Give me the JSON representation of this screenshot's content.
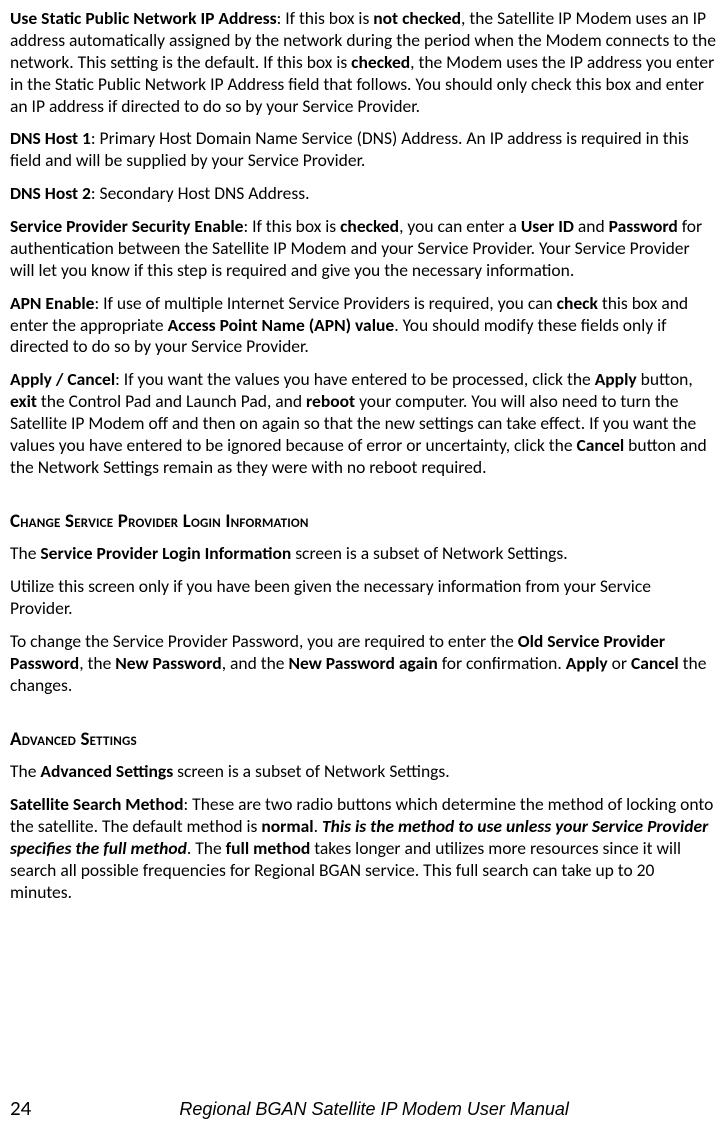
{
  "paragraphs": {
    "p1_b1": "Use Static Public Network IP Address",
    "p1_t1": ": If this box is ",
    "p1_b2": "not checked",
    "p1_t2": ", the Satellite IP Modem uses an IP address automatically assigned by the network during the period when the Modem connects to the network. This setting is the default. If this box is ",
    "p1_b3": "checked",
    "p1_t3": ", the Modem uses the IP address you enter in the Static Public Network IP Address field that follows. You should only check this box and enter an IP address if directed to do so by your Service Provider.",
    "p2_b1": "DNS Host 1",
    "p2_t1": ": Primary Host Domain Name Service (DNS) Address. An IP address is required in this field and will be supplied by your Service Provider.",
    "p3_b1": "DNS Host 2",
    "p3_t1": ": Secondary Host DNS Address.",
    "p4_b1": "Service Provider Security Enable",
    "p4_t1": ": If this box is ",
    "p4_b2": "checked",
    "p4_t2": ", you can enter a ",
    "p4_b3": "User ID",
    "p4_t3": " and ",
    "p4_b4": "Password",
    "p4_t4": " for authentication between the Satellite IP Modem and your Service Provider. Your Service Provider will let you know if this step is required and give you the necessary information.",
    "p5_b1": "APN Enable",
    "p5_t1": ": If use of multiple Internet Service Providers is required, you can ",
    "p5_b2": "check",
    "p5_t2": " this box and enter the appropriate ",
    "p5_b3": "Access Point Name (APN) value",
    "p5_t3": ". You should modify these fields only if directed to do so by your Service Provider.",
    "p6_b1": "Apply / Cancel",
    "p6_t1": ": If you want the values you have entered to be processed, click the ",
    "p6_b2": "Apply",
    "p6_t2": " button, ",
    "p6_b3": "exit",
    "p6_t3": " the Control Pad and Launch Pad, and ",
    "p6_b4": "reboot",
    "p6_t4": " your computer. You will also need to turn the Satellite IP Modem off and then on again so that the new settings can take effect. If you want the values you have entered to be ignored because of error or uncertainty, click the ",
    "p6_b5": "Cancel",
    "p6_t5": " button and the Network Settings remain as they were with no reboot required."
  },
  "heading1": "Change Service Provider Login Information",
  "section1": {
    "s1_t1": "The ",
    "s1_b1": "Service Provider Login Information",
    "s1_t2": "  screen is a subset of Network Settings.",
    "s2_t1": "Utilize this screen only if you have been given the necessary information from your Service Provider.",
    "s3_t1": "To change the Service Provider Password, you are required to enter the ",
    "s3_b1": "Old Service Provider Password",
    "s3_t2": ", the ",
    "s3_b2": "New Password",
    "s3_t3": ", and the ",
    "s3_b3": "New Password again",
    "s3_t4": " for confirmation. ",
    "s3_b4": "Apply",
    "s3_t5": " or ",
    "s3_b5": "Cancel",
    "s3_t6": " the changes."
  },
  "heading2": "Advanced Settings",
  "section2": {
    "a1_t1": "The ",
    "a1_b1": "Advanced Settings",
    "a1_t2": " screen is a subset of Network Settings.",
    "a2_b1": "Satellite Search Method",
    "a2_t1": ": These are two radio buttons which determine the method of locking onto the satellite. The default method is ",
    "a2_b2": "normal",
    "a2_t2": ". ",
    "a2_bi1": "This is the method to use unless your Service Provider specifies the full method",
    "a2_t3": ". The ",
    "a2_b3": "full method",
    "a2_t4": " takes longer and utilizes more resources since it will search all possible frequencies for Regional BGAN service. This full search can take up to 20 minutes."
  },
  "footer": {
    "page": "24",
    "title": "Regional BGAN Satellite IP Modem User Manual"
  }
}
